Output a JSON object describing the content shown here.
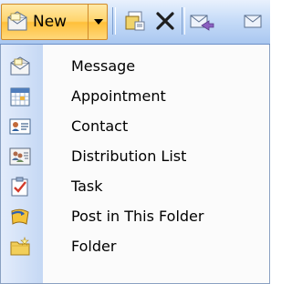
{
  "toolbar": {
    "new_label": "New"
  },
  "menu": {
    "items": [
      {
        "label": "Message",
        "icon": "message-icon"
      },
      {
        "label": "Appointment",
        "icon": "appointment-icon"
      },
      {
        "label": "Contact",
        "icon": "contact-icon"
      },
      {
        "label": "Distribution List",
        "icon": "distribution-list-icon"
      },
      {
        "label": "Task",
        "icon": "task-icon"
      },
      {
        "label": "Post in This Folder",
        "icon": "post-icon"
      },
      {
        "label": "Folder",
        "icon": "folder-icon"
      }
    ]
  },
  "colors": {
    "toolbar_gradient_top": "#e9f1fd",
    "toolbar_gradient_bottom": "#a9c7f0",
    "new_button_highlight": "#ffd46b",
    "menu_gutter": "#c5d8f4"
  }
}
